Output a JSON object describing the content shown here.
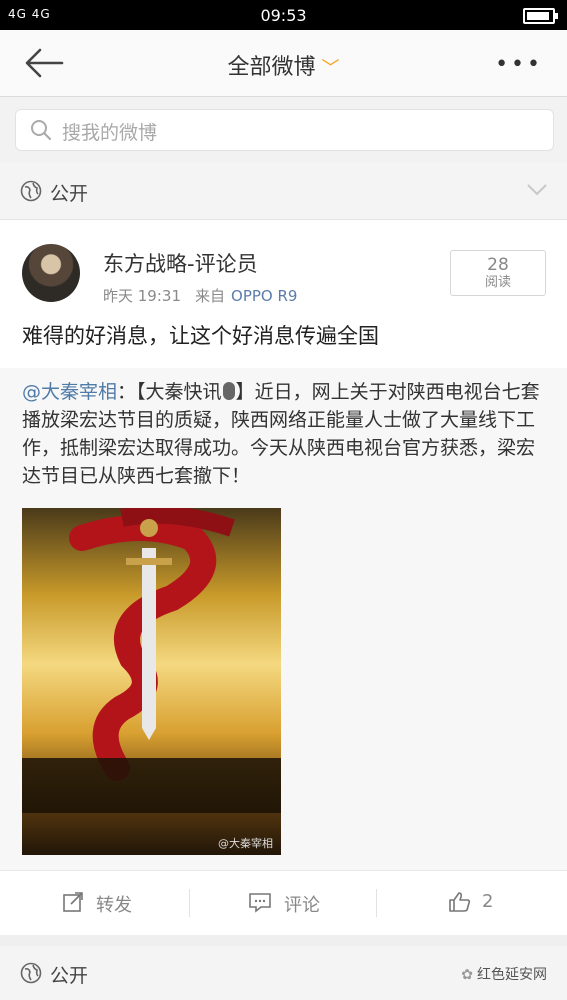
{
  "status_bar": {
    "network": "4G 4G",
    "time": "09:53",
    "battery_level": 0.92
  },
  "nav": {
    "title": "全部微博",
    "more": "•••"
  },
  "search": {
    "placeholder": "搜我的微博"
  },
  "privacy": {
    "label": "公开"
  },
  "post": {
    "author": "东方战略-评论员",
    "time": "昨天 19:31",
    "source_prefix": "来自",
    "device": "OPPO R9",
    "reads_count": "28",
    "reads_label": "阅读",
    "text": "难得的好消息，让这个好消息传遍全国"
  },
  "repost": {
    "mention": "@大秦宰相",
    "colon": "：",
    "tag_open": "【大秦快讯",
    "tag_close": "】",
    "body": "近日，网上关于对陕西电视台七套播放梁宏达节目的质疑，陕西网络正能量人士做了大量线下工作，抵制梁宏达取得成功。今天从陕西电视台官方获悉，梁宏达节目已从陕西七套撤下！",
    "image_watermark": "@大秦宰相"
  },
  "actions": {
    "repost": "转发",
    "comment": "评论",
    "like_count": "2"
  },
  "next_card": {
    "privacy": "公开",
    "watermark": "红色延安网"
  },
  "colors": {
    "accent_orange": "#f4a31b",
    "link_blue": "#4f7ba8"
  }
}
